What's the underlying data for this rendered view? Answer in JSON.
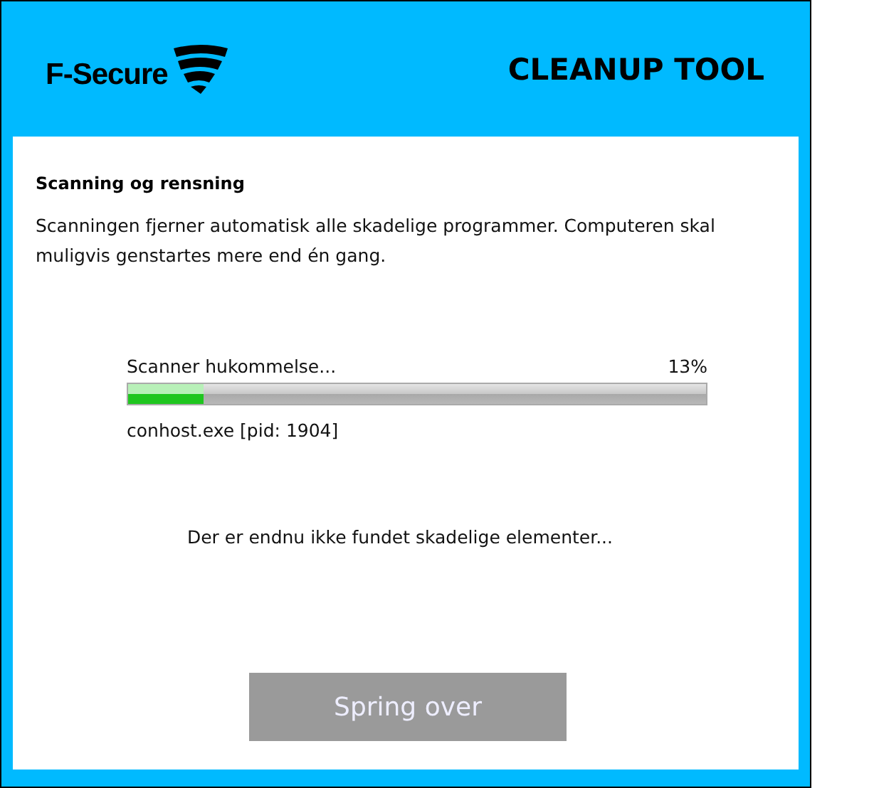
{
  "header": {
    "brand": "F-Secure",
    "title": "CLEANUP TOOL"
  },
  "section": {
    "heading": "Scanning og rensning",
    "description": "Scanningen fjerner automatisk alle skadelige programmer. Computeren skal muligvis genstartes mere end én gang."
  },
  "progress": {
    "label": "Scanner hukommelse...",
    "percent": "13%",
    "level": 0.13,
    "current_item": "conhost.exe [pid: 1904]"
  },
  "status_message": "Der er endnu ikke fundet skadelige elementer...",
  "button": {
    "label": "Spring over",
    "disabled": true
  }
}
